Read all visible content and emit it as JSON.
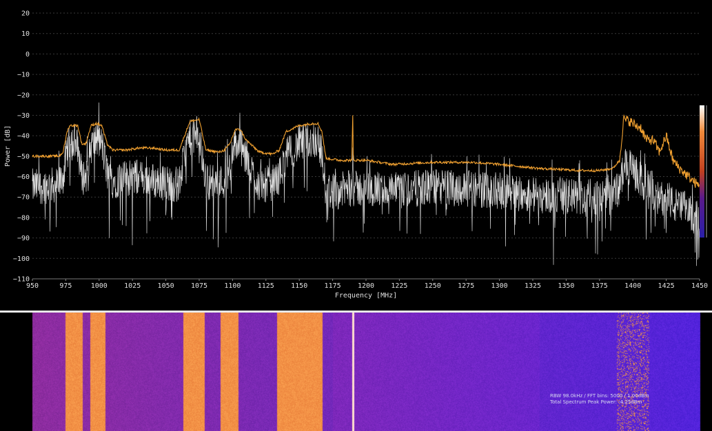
{
  "chart_data": [
    {
      "type": "line",
      "title": "",
      "xlabel": "Frequency [MHz]",
      "ylabel": "Power [dB]",
      "xlim": [
        950,
        1450
      ],
      "ylim": [
        -110,
        20
      ],
      "grid": true,
      "x_ticks": [
        "950",
        "975",
        "1000",
        "1025",
        "1050",
        "1075",
        "1100",
        "1125",
        "1150",
        "1175",
        "1200",
        "1225",
        "1250",
        "1275",
        "1300",
        "1325",
        "1350",
        "1375",
        "1400",
        "1425",
        "1450"
      ],
      "y_ticks": [
        "20",
        "10",
        "0",
        "−10",
        "−20",
        "−30",
        "−40",
        "−50",
        "−60",
        "−70",
        "−80",
        "−90",
        "−100",
        "−110"
      ],
      "series": [
        {
          "role": "max-hold",
          "color": "#f0a030",
          "x": [
            950,
            970,
            973,
            976,
            978,
            984,
            987,
            990,
            994,
            998,
            1002,
            1006,
            1010,
            1020,
            1030,
            1040,
            1050,
            1060,
            1064,
            1068,
            1075,
            1077,
            1080,
            1090,
            1094,
            1098,
            1102,
            1106,
            1110,
            1120,
            1130,
            1135,
            1140,
            1150,
            1160,
            1164,
            1167,
            1170,
            1180,
            1189.5,
            1190,
            1190.5,
            1200,
            1220,
            1250,
            1280,
            1300,
            1330,
            1360,
            1375,
            1385,
            1390,
            1393,
            1398,
            1402,
            1406,
            1410,
            1415,
            1420,
            1425,
            1430,
            1435,
            1440,
            1445,
            1450
          ],
          "y": [
            -50,
            -50,
            -48,
            -38,
            -35,
            -35,
            -44,
            -44,
            -35,
            -34,
            -35,
            -44,
            -47,
            -47,
            -46,
            -46,
            -47,
            -47,
            -40,
            -33,
            -32,
            -38,
            -47,
            -48,
            -47,
            -44,
            -37,
            -37,
            -42,
            -48,
            -49,
            -47,
            -38,
            -35,
            -34,
            -34,
            -38,
            -51,
            -52,
            -52,
            -26,
            -52,
            -52,
            -54,
            -53,
            -53,
            -54,
            -56,
            -57,
            -57,
            -56,
            -52,
            -32,
            -33,
            -35,
            -36,
            -42,
            -42,
            -48,
            -40,
            -52,
            -56,
            -59,
            -62,
            -65
          ]
        },
        {
          "role": "live",
          "color": "#e8e8e8",
          "x": [
            950,
            970,
            973,
            976,
            978,
            984,
            987,
            990,
            994,
            998,
            1002,
            1006,
            1010,
            1020,
            1030,
            1040,
            1050,
            1060,
            1064,
            1068,
            1075,
            1077,
            1080,
            1090,
            1094,
            1098,
            1102,
            1106,
            1110,
            1120,
            1130,
            1135,
            1140,
            1150,
            1160,
            1164,
            1167,
            1170,
            1180,
            1189.5,
            1190,
            1190.5,
            1200,
            1220,
            1250,
            1280,
            1300,
            1330,
            1360,
            1375,
            1385,
            1390,
            1393,
            1398,
            1402,
            1406,
            1410,
            1415,
            1420,
            1425,
            1430,
            1435,
            1440,
            1445,
            1450
          ],
          "y": [
            -65,
            -64,
            -60,
            -48,
            -43,
            -45,
            -60,
            -60,
            -45,
            -42,
            -44,
            -58,
            -62,
            -61,
            -60,
            -62,
            -63,
            -64,
            -50,
            -41,
            -40,
            -50,
            -62,
            -63,
            -62,
            -55,
            -44,
            -45,
            -52,
            -64,
            -63,
            -60,
            -50,
            -44,
            -42,
            -42,
            -50,
            -67,
            -67,
            -65,
            -45,
            -66,
            -66,
            -67,
            -65,
            -66,
            -67,
            -69,
            -70,
            -70,
            -68,
            -66,
            -55,
            -56,
            -58,
            -62,
            -65,
            -66,
            -73,
            -68,
            -74,
            -75,
            -76,
            -79,
            -80
          ]
        }
      ]
    },
    {
      "type": "heatmap",
      "role": "waterfall",
      "xlim": [
        950,
        1450
      ],
      "x_bands_mhz": [
        [
          974.5,
          987.5
        ],
        [
          993,
          1004.5
        ],
        [
          1063,
          1079
        ],
        [
          1091,
          1104
        ],
        [
          1133,
          1167
        ]
      ],
      "x_narrow_mhz": [
        1190
      ],
      "x_bursty_mhz": [
        1388,
        1412
      ]
    }
  ],
  "waterfall": {
    "info_line1": "RBW 98.0kHz / FFT bins: 5000 / 1.00dBm",
    "info_line2": "Total Spectrum Peak Power: -4.25dBm"
  },
  "colors": {
    "background": "#000000",
    "grid": "#3a3a3a",
    "axis_text": "#e0e0e0",
    "max_hold": "#f0a030",
    "live_trace": "#e8e8e8",
    "waterfall_floor": "#2a1fa8",
    "waterfall_mid": "#6a2a98",
    "waterfall_hot": "#f08a3a",
    "separator": "#e8e8e8"
  }
}
